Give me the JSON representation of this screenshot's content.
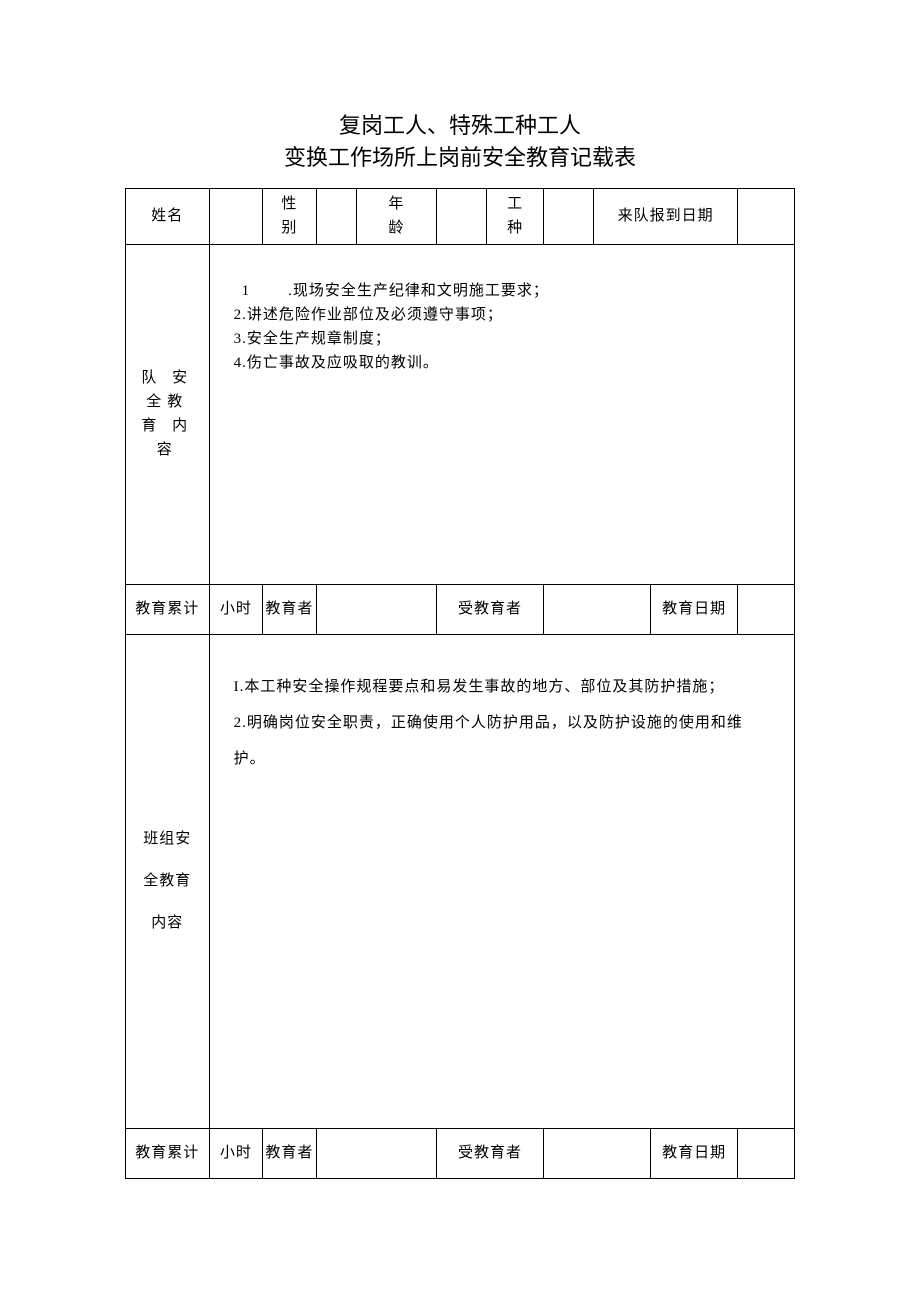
{
  "title": {
    "line1": "复岗工人、特殊工种工人",
    "line2": "变换工作场所上岗前安全教育记载表"
  },
  "row1": {
    "name_label": "姓名",
    "gender_label_top": "性",
    "gender_label_bottom": "别",
    "age_label_top": "年",
    "age_label_bottom": "龄",
    "worktype_label_top": "工",
    "worktype_label_bottom": "种",
    "arrive_label": "来队报到日期",
    "name_value": "",
    "gender_value": "",
    "age_value": "",
    "worktype_value": "",
    "arrive_value": ""
  },
  "section1": {
    "label": "队 安 全教 育 内容",
    "content": {
      "l1a": "1",
      "l1b": ".现场安全生产纪律和文明施工要求；",
      "l2": "2.讲述危险作业部位及必须遵守事项；",
      "l3": "3.安全生产规章制度；",
      "l4": "4.伤亡事故及应吸取的教训。"
    }
  },
  "midrow": {
    "total_label": "教育累计",
    "hours_label": "小时",
    "educator_label": "教育者",
    "educator_value": "",
    "educatee_label": "受教育者",
    "educatee_value": "",
    "date_label": "教育日期",
    "date_value": ""
  },
  "section2": {
    "label": "班组安全教育内容",
    "content": {
      "l1": "I.本工种安全操作规程要点和易发生事故的地方、部位及其防护措施；",
      "l2": "2.明确岗位安全职责，正确使用个人防护用品，以及防护设施的使用和维护。"
    }
  },
  "midrow2": {
    "total_label": "教育累计",
    "hours_label": "小时",
    "educator_label": "教育者",
    "educator_value": "",
    "educatee_label": "受教育者",
    "educatee_value": "",
    "date_label": "教育日期",
    "date_value": ""
  }
}
